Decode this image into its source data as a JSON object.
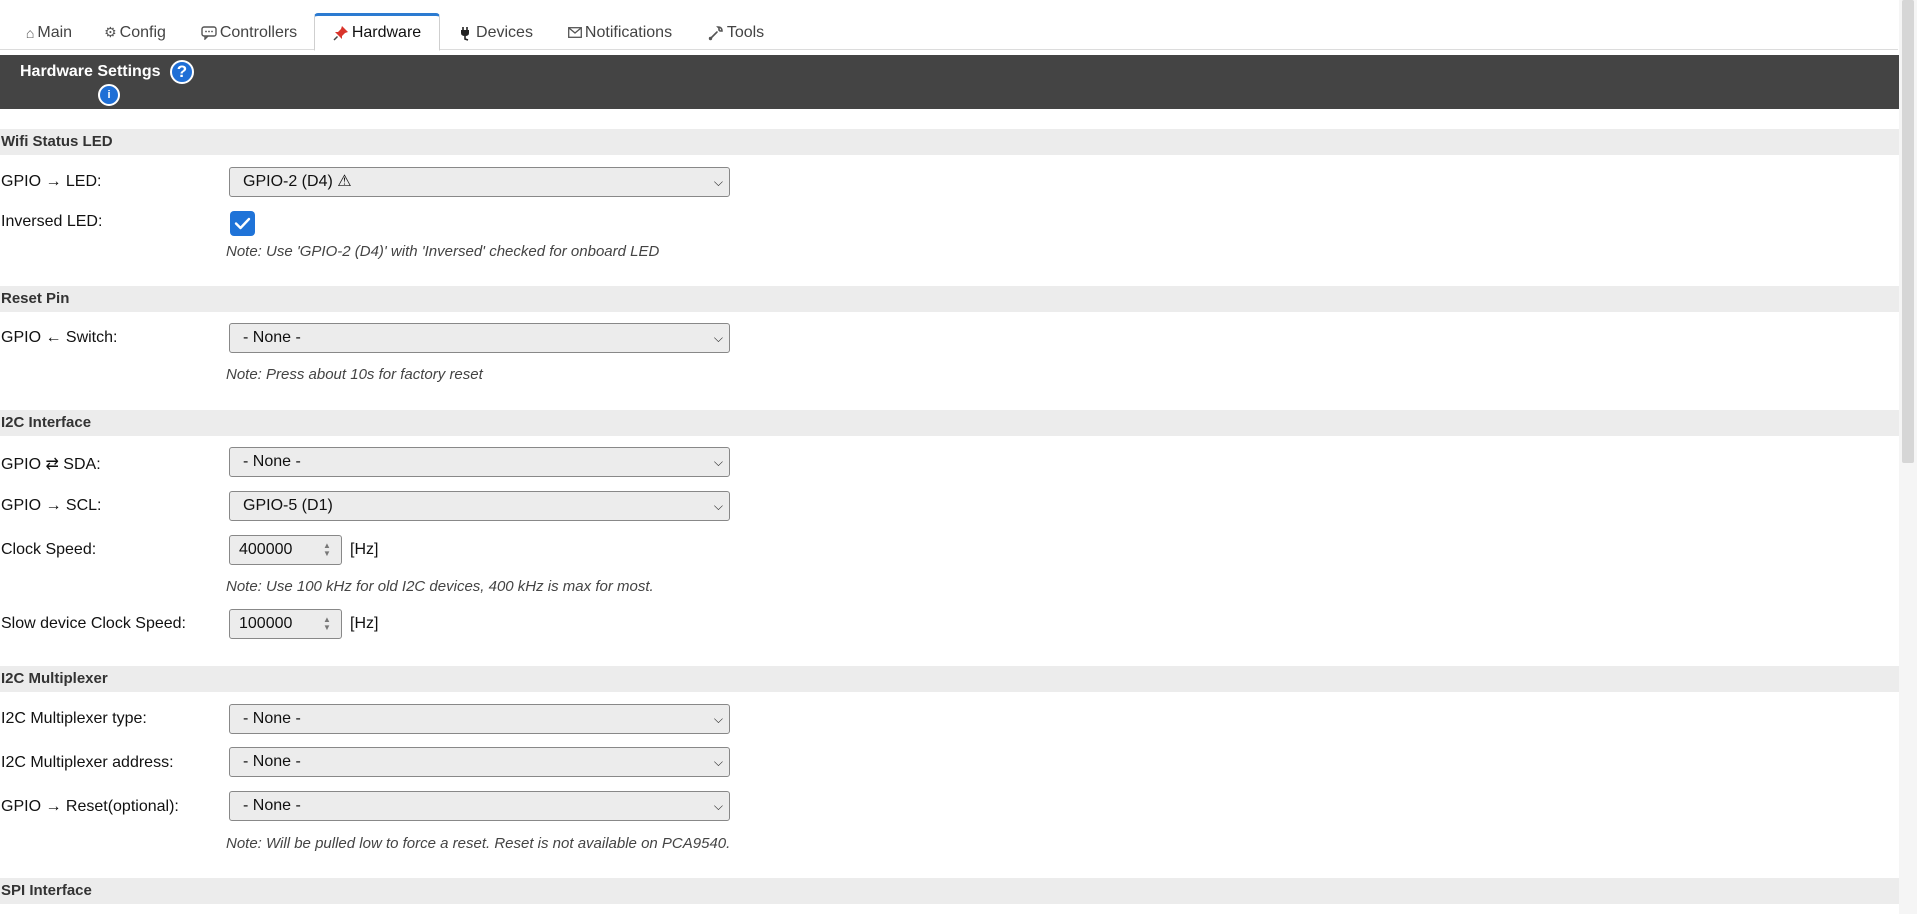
{
  "tabs": [
    {
      "label": "Main",
      "icon": "home-icon",
      "glyph": "⌂"
    },
    {
      "label": "Config",
      "icon": "gear-icon",
      "glyph": "⚙"
    },
    {
      "label": "Controllers",
      "icon": "chat-bubble-icon",
      "glyph": "💬"
    },
    {
      "label": "Hardware",
      "icon": "pushpin-icon",
      "glyph": "📌",
      "active": true
    },
    {
      "label": "Devices",
      "icon": "plug-icon",
      "glyph": "🔌"
    },
    {
      "label": "Notifications",
      "icon": "envelope-icon",
      "glyph": "✉"
    },
    {
      "label": "Tools",
      "icon": "wrench-icon",
      "glyph": "🔧"
    }
  ],
  "header": {
    "title": "Hardware Settings",
    "help_glyph": "?",
    "info_glyph": "i"
  },
  "sections": {
    "wifi_led": {
      "title": "Wifi Status LED",
      "gpio_label": "GPIO → LED:",
      "gpio_value": "GPIO-2 (D4) ⚠",
      "inversed_label": "Inversed LED:",
      "inversed_checked": true,
      "note": "Note: Use 'GPIO-2 (D4)' with 'Inversed' checked for onboard LED"
    },
    "reset_pin": {
      "title": "Reset Pin",
      "switch_label": "GPIO ← Switch:",
      "switch_value": "- None -",
      "note": "Note: Press about 10s for factory reset"
    },
    "i2c": {
      "title": "I2C Interface",
      "sda_label": "GPIO ⇄ SDA:",
      "sda_value": "- None -",
      "scl_label": "GPIO → SCL:",
      "scl_value": "GPIO-5 (D1)",
      "clock_label": "Clock Speed:",
      "clock_value": "400000",
      "clock_unit": "[Hz]",
      "clock_note": "Note: Use 100 kHz for old I2C devices, 400 kHz is max for most.",
      "slow_label": "Slow device Clock Speed:",
      "slow_value": "100000",
      "slow_unit": "[Hz]"
    },
    "i2c_mux": {
      "title": "I2C Multiplexer",
      "type_label": "I2C Multiplexer type:",
      "type_value": "- None -",
      "address_label": "I2C Multiplexer address:",
      "address_value": "- None -",
      "reset_label": "GPIO → Reset(optional):",
      "reset_value": "- None -",
      "note": "Note: Will be pulled low to force a reset. Reset is not available on PCA9540."
    },
    "spi": {
      "title": "SPI Interface"
    }
  },
  "colors": {
    "accent": "#2c7bd1",
    "header_band": "#444444",
    "section_bg": "#ececec",
    "checkbox": "#1f73d8"
  }
}
